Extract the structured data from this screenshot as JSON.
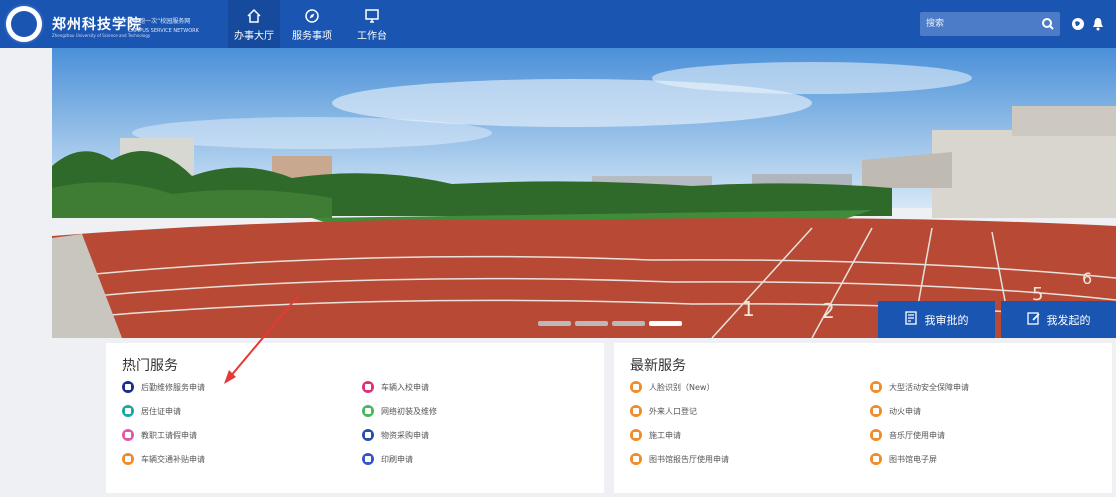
{
  "header": {
    "school_name": "郑州科技学院",
    "school_name_en": "Zhengzhou University of Science and Technology",
    "slogan": "“最多跑一次”校园服务网",
    "slogan_en": "CAMPUS SERVICE NETWORK",
    "nav": [
      {
        "label": "办事大厅",
        "icon": "home-icon",
        "active": true
      },
      {
        "label": "服务事项",
        "icon": "compass-icon",
        "active": false
      },
      {
        "label": "工作台",
        "icon": "monitor-icon",
        "active": false
      }
    ],
    "search": {
      "placeholder": "搜索"
    }
  },
  "banner": {
    "slides": 4,
    "active_slide": 4,
    "track_numbers": [
      "1",
      "2",
      "5",
      "6"
    ],
    "approve_label": "我审批的",
    "initiate_label": "我发起的"
  },
  "hot_services": {
    "title": "热门服务",
    "items": [
      {
        "label": "后勤维修服务申请",
        "color": "#1c2f8a"
      },
      {
        "label": "车辆入校申请",
        "color": "#e0307c"
      },
      {
        "label": "居住证申请",
        "color": "#1aa6a6"
      },
      {
        "label": "网络初装及维修",
        "color": "#49b75b"
      },
      {
        "label": "教职工请假申请",
        "color": "#e05aa9"
      },
      {
        "label": "物资采购申请",
        "color": "#2a4fa8"
      },
      {
        "label": "车辆交通补贴申请",
        "color": "#f08a2a"
      },
      {
        "label": "印刷申请",
        "color": "#3555c4"
      }
    ]
  },
  "new_services": {
    "title": "最新服务",
    "items": [
      {
        "label": "人脸识别（New）",
        "color": "#f08a2a"
      },
      {
        "label": "大型活动安全保障申请",
        "color": "#f08a2a"
      },
      {
        "label": "外来人口登记",
        "color": "#f08a2a"
      },
      {
        "label": "动火申请",
        "color": "#f08a2a"
      },
      {
        "label": "施工申请",
        "color": "#f08a2a"
      },
      {
        "label": "音乐厅使用申请",
        "color": "#f08a2a"
      },
      {
        "label": "图书馆报告厅使用申请",
        "color": "#f08a2a"
      },
      {
        "label": "图书馆电子屏",
        "color": "#f08a2a"
      }
    ]
  },
  "colors": {
    "brand": "#1a55b2",
    "arrow": "#e53935"
  }
}
